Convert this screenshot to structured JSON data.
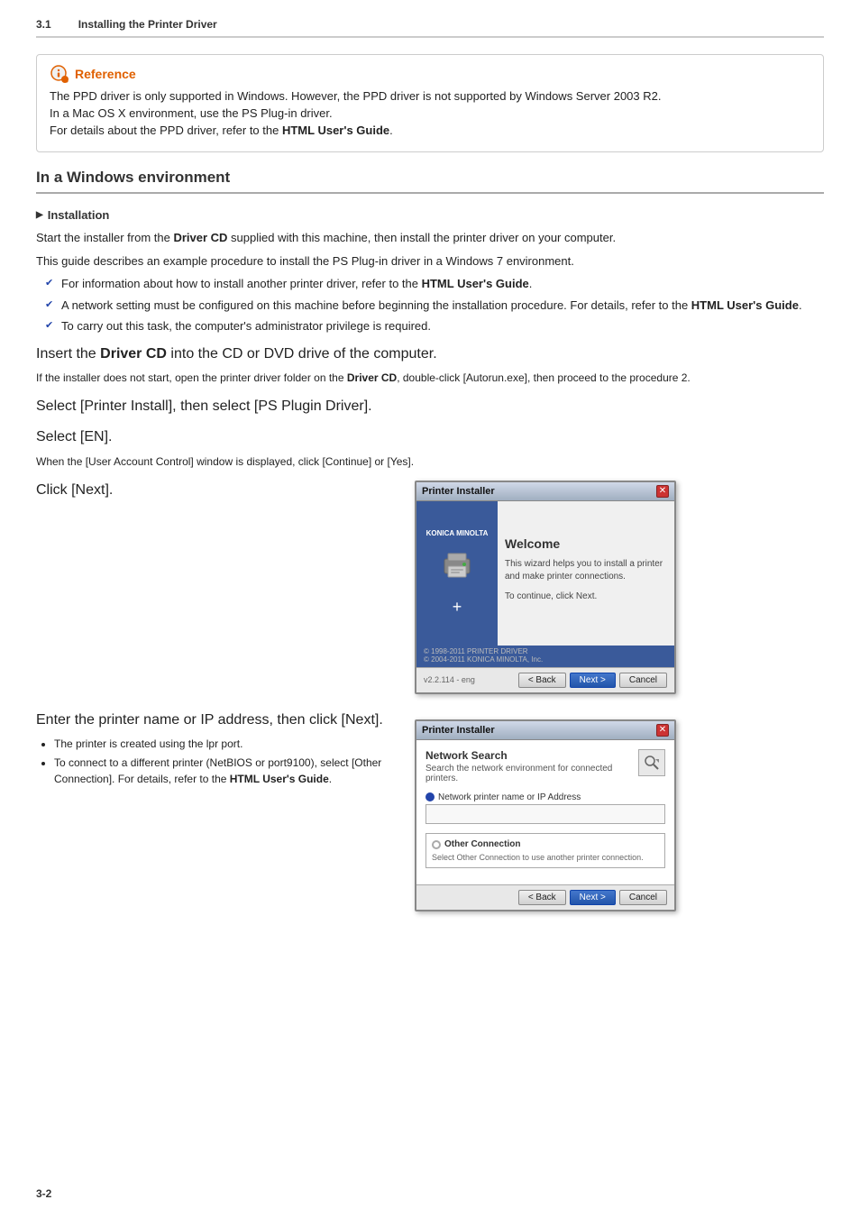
{
  "header": {
    "section": "3.1",
    "title": "Installing the Printer Driver"
  },
  "reference": {
    "title": "Reference",
    "lines": [
      "The PPD driver is only supported in Windows. However, the PPD driver is not supported by Windows Server 2003 R2.",
      "In a Mac OS X environment, use the PS Plug-in driver.",
      "For details about the PPD driver, refer to the HTML User's Guide."
    ],
    "bold_parts": [
      "HTML User's Guide"
    ]
  },
  "section": {
    "title": "In a Windows environment"
  },
  "installation": {
    "heading": "Installation",
    "para1": "Start the installer from the Driver CD supplied with this machine, then install the printer driver on your computer.",
    "para2": "This guide describes an example procedure to install the PS Plug-in driver in a Windows 7 environment.",
    "bullets": [
      "For information about how to install another printer driver, refer to the HTML User's Guide.",
      "A network setting must be configured on this machine before beginning the installation procedure. For details, refer to the HTML User's Guide.",
      "To carry out this task, the computer's administrator privilege is required."
    ]
  },
  "steps": [
    {
      "id": "step1",
      "main_text": "Insert the Driver CD into the CD or DVD drive of the computer.",
      "sub_text": "If the installer does not start, open the printer driver folder on the Driver CD, double-click [Autorun.exe], then proceed to the procedure 2.",
      "has_window": false
    },
    {
      "id": "step2",
      "main_text": "Select [Printer Install], then select [PS Plugin Driver].",
      "sub_text": "",
      "has_window": false
    },
    {
      "id": "step3",
      "main_text": "Select [EN].",
      "sub_text": "When the [User Account Control] window is displayed, click [Continue] or [Yes].",
      "has_window": false
    },
    {
      "id": "step4",
      "main_text": "Click [Next].",
      "sub_text": "",
      "has_window": true,
      "window_type": "welcome"
    },
    {
      "id": "step5",
      "main_text": "Enter the printer name or IP address, then click [Next].",
      "sub_text": "",
      "has_window": true,
      "window_type": "network",
      "bullets": [
        "The printer is created using the lpr port.",
        "To connect to a different printer (NetBIOS or port9100), select [Other Connection]. For details, refer to the HTML User's Guide."
      ]
    }
  ],
  "welcome_window": {
    "title": "Printer Installer",
    "close": "✕",
    "brand": "KONICA MINOLTA",
    "welcome_heading": "Welcome",
    "welcome_text1": "This wizard helps you to install a printer and make printer connections.",
    "welcome_text2": "To continue, click Next.",
    "version": "v2.2.114 - eng",
    "copyright1": "© 1998-2011 PRINTER DRIVER",
    "copyright2": "© 2004-2011 KONICA MINOLTA, Inc.",
    "btn_back": "< Back",
    "btn_next": "Next >",
    "btn_cancel": "Cancel"
  },
  "network_window": {
    "title": "Printer Installer",
    "close": "✕",
    "heading": "Network Search",
    "subheading": "Search the network environment for connected printers.",
    "field_label": "Network printer name or IP Address",
    "option_label": "Other Connection",
    "option_sub": "Select Other Connection to use another printer connection.",
    "btn_back": "< Back",
    "btn_next": "Next >",
    "btn_cancel": "Cancel"
  },
  "footer": {
    "page_num": "3-2"
  }
}
